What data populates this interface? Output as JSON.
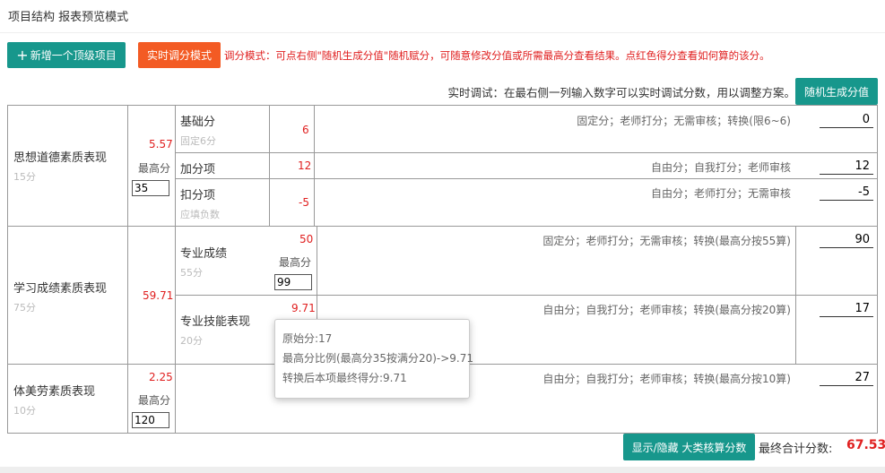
{
  "page_title": "项目结构 报表预览模式",
  "toolbar": {
    "add_icon": "plus-icon",
    "add_label": "新增一个顶级项目",
    "mode_label": "实时调分模式",
    "notice": "调分模式：可点右侧\"随机生成分值\"随机赋分，可随意修改分值或所需最高分查看结果。点红色得分查看如何算的该分。"
  },
  "hint": {
    "text": "实时调试：在最右侧一列输入数字可以实时调试分数，用以调整方案。",
    "random_label": "随机生成分值"
  },
  "groups": [
    {
      "name": "思想道德素质表现",
      "sub": "15分",
      "score": "5.57",
      "max_label": "最高分",
      "max_value": "35",
      "items": [
        {
          "name": "基础分",
          "sub": "固定6分",
          "score": "6",
          "desc": "固定分；老师打分；无需审核；转换(限6~6)",
          "input": "0"
        },
        {
          "name": "加分项",
          "sub": "",
          "score": "12",
          "desc": "自由分；自我打分；老师审核",
          "input": "12"
        },
        {
          "name": "扣分项",
          "sub": "应填负数",
          "score": "-5",
          "desc": "自由分；老师打分；无需审核",
          "input": "-5"
        }
      ]
    },
    {
      "name": "学习成绩素质表现",
      "sub": "75分",
      "score": "59.71",
      "items": [
        {
          "name": "专业成绩",
          "sub": "55分",
          "score": "50",
          "max_label": "最高分",
          "max_value": "99",
          "desc": "固定分；老师打分；无需审核；转换(最高分按55算)",
          "input": "90"
        },
        {
          "name": "专业技能表现",
          "sub": "20分",
          "score": "9.71",
          "desc": "自由分；自我打分；老师审核；转换(最高分按20算)",
          "input": "17"
        }
      ]
    },
    {
      "name": "体美劳素质表现",
      "sub": "10分",
      "score": "2.25",
      "max_label": "最高分",
      "max_value": "120",
      "desc": "自由分；自我打分；老师审核；转换(最高分按10算)",
      "input": "27"
    }
  ],
  "tooltip": {
    "line1": "原始分:17",
    "line2": "最高分比例(最高分35按满分20)->9.71",
    "line3": "转换后本项最终得分:9.71"
  },
  "footer": {
    "toggle_label": "显示/隐藏 大类核算分数",
    "final_label": "最终合计分数:",
    "final_value": "67.53"
  },
  "colors": {
    "teal": "#17978c",
    "orange": "#f35b24",
    "red": "#e02020"
  }
}
